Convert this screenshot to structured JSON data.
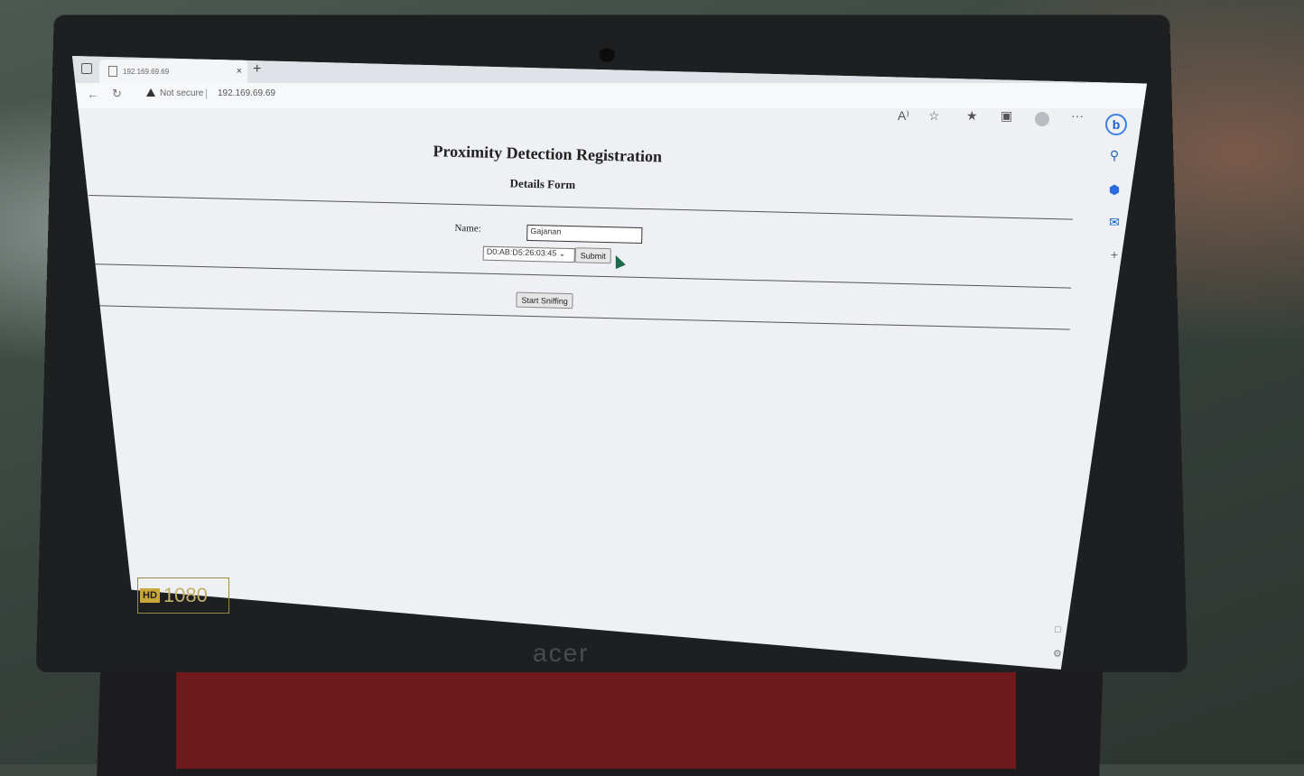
{
  "browser": {
    "tab_title": "192.169.69.69",
    "tab_close": "×",
    "new_tab": "+",
    "security_label": "Not secure",
    "address_url": "192.169.69.69",
    "separator": "|",
    "window_controls": [
      "—",
      "❐",
      "✕"
    ]
  },
  "toolbar": {
    "read_aloud": "A⁾",
    "more": "···"
  },
  "page": {
    "heading": "Proximity Detection Registration",
    "subheading": "Details Form",
    "name_label": "Name:",
    "name_value": "Gajanan",
    "device_selected": "D0:AB:D5:26:03:45",
    "submit_label": "Submit",
    "sniff_label": "Start Sniffing"
  },
  "laptop": {
    "badge_hd": "HD",
    "badge_res": "1080",
    "brand": "acer"
  }
}
